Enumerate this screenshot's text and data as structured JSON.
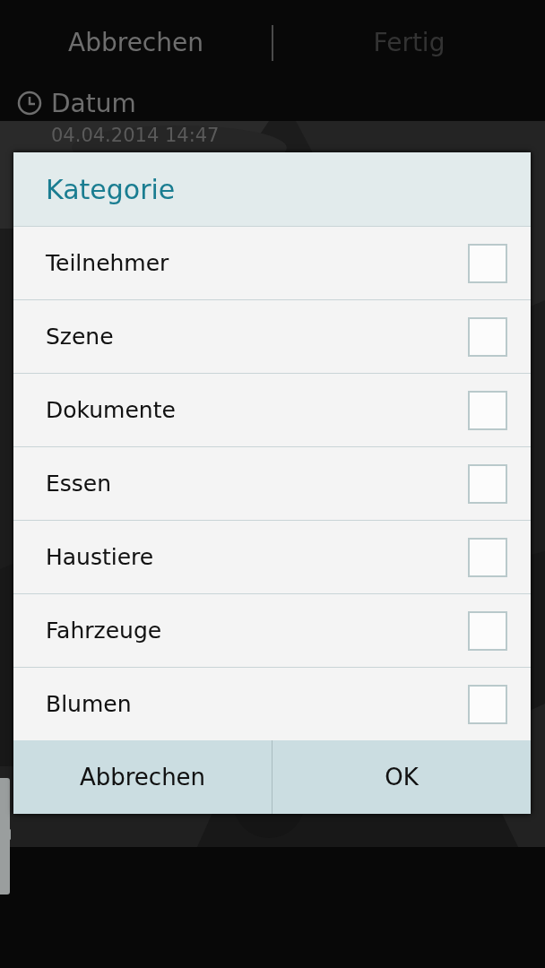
{
  "top_bar": {
    "buttons": [
      {
        "label": "Abbrechen",
        "disabled": false
      },
      {
        "label": "Fertig",
        "disabled": true
      }
    ]
  },
  "section": {
    "title": "Datum",
    "value": "04.04.2014 14:47"
  },
  "dialog": {
    "title": "Kategorie",
    "items": [
      {
        "label": "Teilnehmer",
        "checked": false
      },
      {
        "label": "Szene",
        "checked": false
      },
      {
        "label": "Dokumente",
        "checked": false
      },
      {
        "label": "Essen",
        "checked": false
      },
      {
        "label": "Haustiere",
        "checked": false
      },
      {
        "label": "Fahrzeuge",
        "checked": false
      },
      {
        "label": "Blumen",
        "checked": false
      }
    ],
    "buttons": [
      "Abbrechen",
      "OK"
    ]
  }
}
